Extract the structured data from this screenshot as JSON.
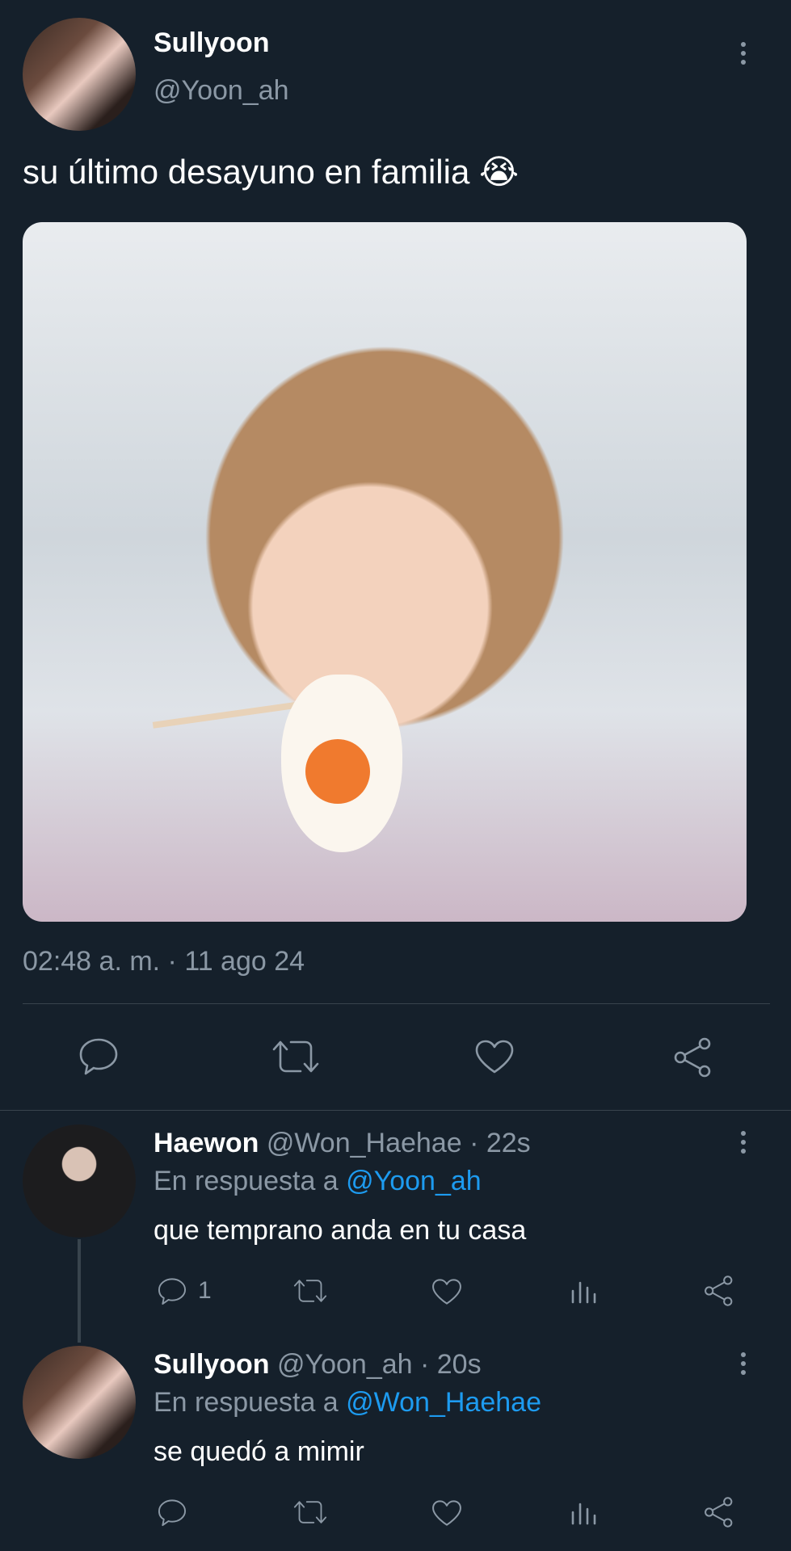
{
  "tweet": {
    "author_name": "Sullyoon",
    "author_handle": "@Yoon_ah",
    "text": "su último desayuno en familia 😭",
    "timestamp": "02:48 a. m. · 11 ago 24"
  },
  "replies": [
    {
      "author_name": "Haewon",
      "meta": "@Won_Haehae · 22s",
      "reply_prefix": "En respuesta a",
      "reply_to": "@Yoon_ah",
      "text": "que temprano anda en tu casa",
      "reply_count": "1"
    },
    {
      "author_name": "Sullyoon",
      "meta": "@Yoon_ah · 20s",
      "reply_prefix": "En respuesta a",
      "reply_to": "@Won_Haehae",
      "text": "se quedó a mimir",
      "reply_count": ""
    }
  ],
  "icons": {
    "reply": "reply-icon",
    "retweet": "retweet-icon",
    "like": "heart-icon",
    "share": "share-icon",
    "views": "views-icon",
    "more": "more-icon"
  },
  "colors": {
    "background": "#15202b",
    "text": "#ffffff",
    "muted": "#8b98a5",
    "link": "#1d9bf0",
    "divider": "#38444d"
  }
}
